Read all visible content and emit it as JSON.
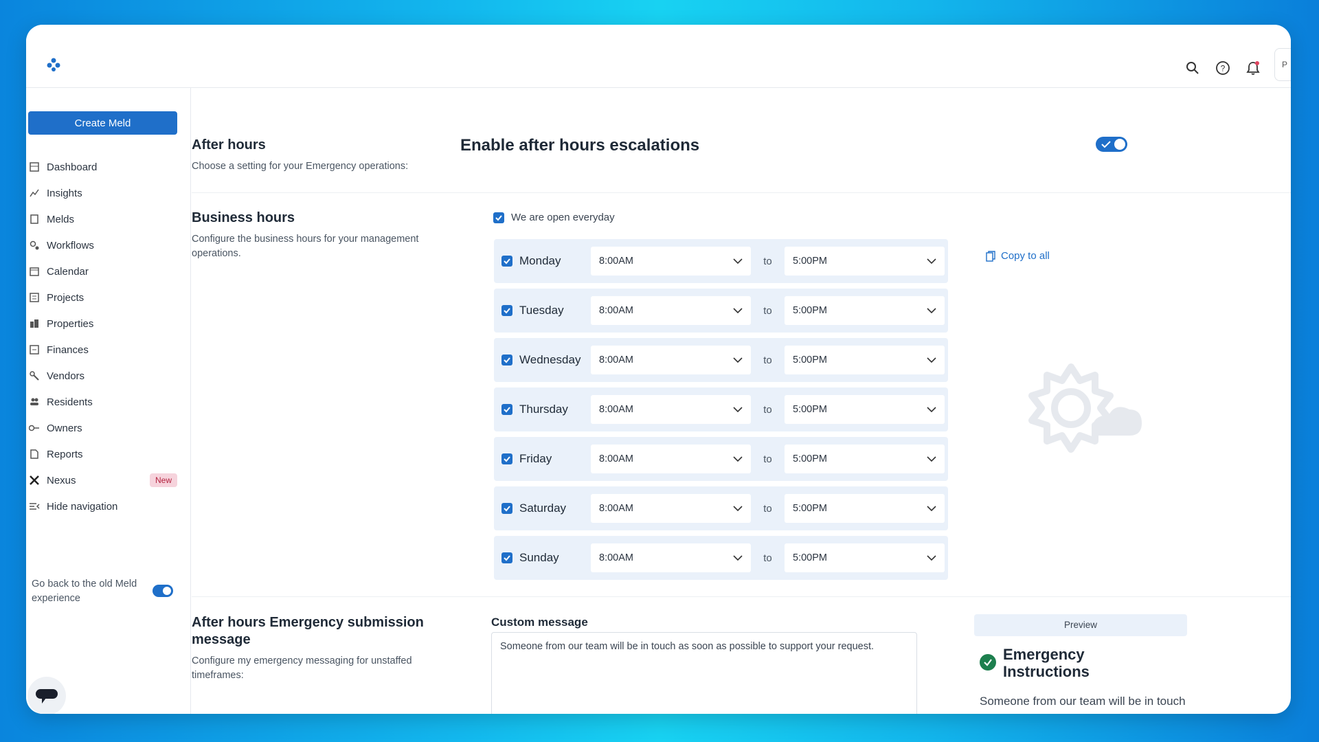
{
  "header": {
    "icons": [
      "logo-icon",
      "search-icon",
      "help-icon",
      "bell-icon"
    ],
    "avatar_text": "P"
  },
  "sidebar": {
    "create_button": "Create Meld",
    "items": [
      {
        "label": "Dashboard",
        "icon": "dashboard-icon"
      },
      {
        "label": "Insights",
        "icon": "insights-icon"
      },
      {
        "label": "Melds",
        "icon": "melds-icon"
      },
      {
        "label": "Workflows",
        "icon": "workflows-icon"
      },
      {
        "label": "Calendar",
        "icon": "calendar-icon"
      },
      {
        "label": "Projects",
        "icon": "projects-icon"
      },
      {
        "label": "Properties",
        "icon": "properties-icon"
      },
      {
        "label": "Finances",
        "icon": "finances-icon"
      },
      {
        "label": "Vendors",
        "icon": "vendors-icon"
      },
      {
        "label": "Residents",
        "icon": "residents-icon"
      },
      {
        "label": "Owners",
        "icon": "owners-icon"
      },
      {
        "label": "Reports",
        "icon": "reports-icon"
      },
      {
        "label": "Nexus",
        "icon": "nexus-icon",
        "badge": "New"
      },
      {
        "label": "Hide navigation",
        "icon": "hide-nav-icon"
      }
    ],
    "old_experience_label": "Go back to the old Meld experience",
    "old_experience_on": true
  },
  "after_hours": {
    "title": "After hours",
    "description": "Choose a setting for your Emergency operations:",
    "enable_label": "Enable after hours escalations",
    "enabled": true
  },
  "business_hours": {
    "title": "Business hours",
    "description": "Configure the business hours for your management operations.",
    "open_everyday_label": "We are open everyday",
    "open_everyday": true,
    "to_label": "to",
    "copy_all_label": "Copy to all",
    "days": [
      {
        "name": "Monday",
        "checked": true,
        "start": "8:00AM",
        "end": "5:00PM"
      },
      {
        "name": "Tuesday",
        "checked": true,
        "start": "8:00AM",
        "end": "5:00PM"
      },
      {
        "name": "Wednesday",
        "checked": true,
        "start": "8:00AM",
        "end": "5:00PM"
      },
      {
        "name": "Thursday",
        "checked": true,
        "start": "8:00AM",
        "end": "5:00PM"
      },
      {
        "name": "Friday",
        "checked": true,
        "start": "8:00AM",
        "end": "5:00PM"
      },
      {
        "name": "Saturday",
        "checked": true,
        "start": "8:00AM",
        "end": "5:00PM"
      },
      {
        "name": "Sunday",
        "checked": true,
        "start": "8:00AM",
        "end": "5:00PM"
      }
    ]
  },
  "emergency_message": {
    "title": "After hours Emergency submission message",
    "description": "Configure my emergency messaging for unstaffed timeframes:",
    "custom_label": "Custom message",
    "custom_text": "Someone from our team will be in touch as soon as possible to support your request.",
    "preview_label": "Preview",
    "preview_title": "Emergency Instructions",
    "preview_text": "Someone from our team will be in touch as soon as possible to"
  },
  "colors": {
    "accent": "#1f6fc9",
    "row_bg": "#eaf1fa",
    "badge_bg": "#f6d3dc"
  }
}
